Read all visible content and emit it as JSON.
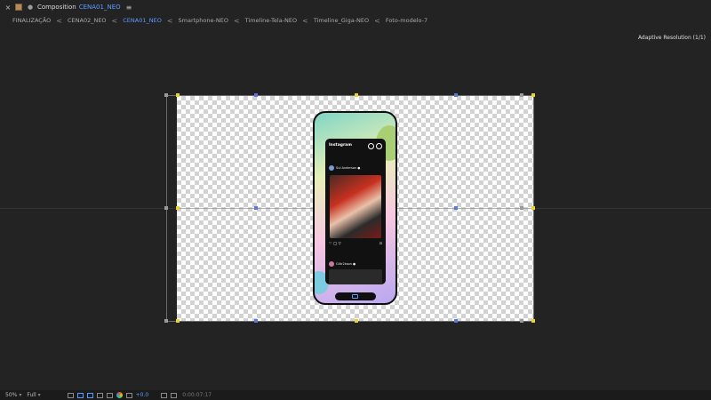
{
  "header": {
    "close_glyph": "×",
    "lock_glyph": "🔒",
    "title": "Composition",
    "comp_name": "CENA01_NEO",
    "menu_glyph": "≡"
  },
  "tabs": [
    {
      "label": "FINALIZAÇÃO",
      "active": false
    },
    {
      "label": "CENA02_NEO",
      "active": false
    },
    {
      "label": "CENA01_NEO",
      "active": true
    },
    {
      "label": "Smartphone-NEO",
      "active": false
    },
    {
      "label": "Timeline-Tela-NEO",
      "active": false
    },
    {
      "label": "Timeline_Giga-NEO",
      "active": false
    },
    {
      "label": "Foto-modelo-7",
      "active": false
    }
  ],
  "tab_separator": "<",
  "viewer": {
    "adaptive_resolution": "Adaptive Resolution (1/1)"
  },
  "phone_screen": {
    "app_name": "Instagram",
    "post1_user": "Sul Anderson ●",
    "post2_user": "Giltr2kson ●",
    "actions": "♡ ◯ ▽",
    "save_glyph": "⊡"
  },
  "footer": {
    "zoom": "50%",
    "resolution": "Full",
    "exposure": "+0.0",
    "timecode": "0:00:07:17"
  },
  "colors": {
    "accent": "#5b9cff",
    "background": "#232323"
  }
}
